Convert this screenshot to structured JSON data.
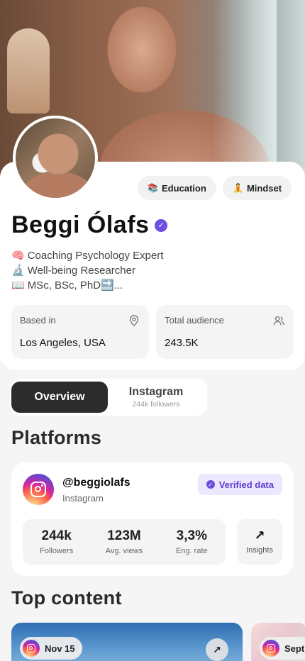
{
  "profile": {
    "name": "Beggi Ólafs",
    "chips": [
      {
        "icon": "📚",
        "label": "Education"
      },
      {
        "icon": "🧘",
        "label": "Mindset"
      }
    ],
    "bio": [
      {
        "icon": "🧠",
        "text": "Coaching Psychology Expert"
      },
      {
        "icon": "🔬",
        "text": "Well-being Researcher"
      },
      {
        "icon": "📖",
        "text": "MSc, BSc, PhD🔜..."
      }
    ],
    "based_in": {
      "label": "Based in",
      "value": "Los Angeles, USA"
    },
    "audience": {
      "label": "Total audience",
      "value": "243.5K"
    }
  },
  "tabs": {
    "active": "Overview",
    "second": {
      "label": "Instagram",
      "sub": "244k followers"
    }
  },
  "platforms": {
    "title": "Platforms",
    "handle": "@beggiolafs",
    "network": "Instagram",
    "verified_label": "Verified data",
    "metrics": [
      {
        "value": "244k",
        "label": "Followers"
      },
      {
        "value": "123M",
        "label": "Avg. views"
      },
      {
        "value": "3,3%",
        "label": "Eng. rate"
      }
    ],
    "insights_label": "Insights"
  },
  "top_content": {
    "title": "Top content",
    "items": [
      {
        "date": "Nov 15"
      },
      {
        "date": "Sept"
      }
    ]
  }
}
